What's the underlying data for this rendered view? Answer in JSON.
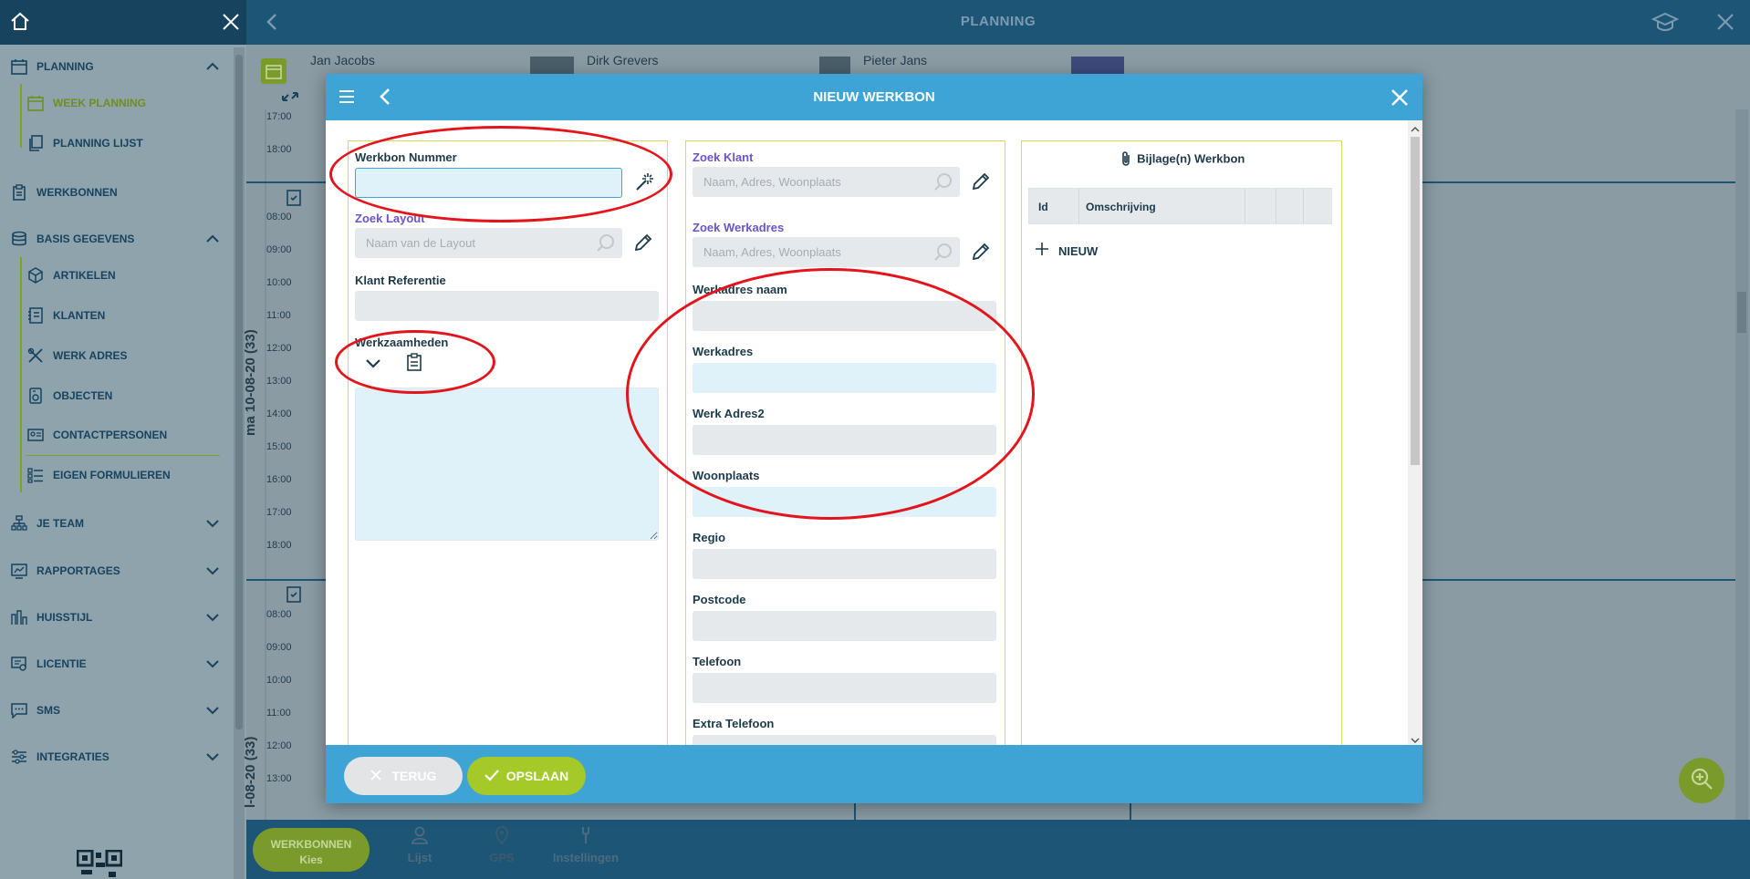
{
  "sidebar": {
    "items": [
      {
        "label": "PLANNING",
        "icon": "calendar-icon",
        "expanded": true
      },
      {
        "label": "WEEK PLANNING",
        "icon": "calendar-icon",
        "active": true
      },
      {
        "label": "PLANNING LIJST",
        "icon": "copy-icon"
      },
      {
        "label": "WERKBONNEN",
        "icon": "clipboard-icon"
      },
      {
        "label": "BASIS GEGEVENS",
        "icon": "database-icon",
        "expanded": true
      },
      {
        "label": "ARTIKELEN",
        "icon": "cube-icon"
      },
      {
        "label": "KLANTEN",
        "icon": "address-book-icon"
      },
      {
        "label": "WERK ADRES",
        "icon": "tools-icon"
      },
      {
        "label": "OBJECTEN",
        "icon": "object-icon"
      },
      {
        "label": "CONTACTPERSONEN",
        "icon": "contact-card-icon"
      },
      {
        "label": "EIGEN FORMULIEREN",
        "icon": "list-icon"
      },
      {
        "label": "JE TEAM",
        "icon": "team-icon"
      },
      {
        "label": "RAPPORTAGES",
        "icon": "report-icon"
      },
      {
        "label": "HUISSTIJL",
        "icon": "brand-icon"
      },
      {
        "label": "LICENTIE",
        "icon": "license-icon"
      },
      {
        "label": "SMS",
        "icon": "sms-icon"
      },
      {
        "label": "INTEGRATIES",
        "icon": "sliders-icon"
      }
    ]
  },
  "topbar": {
    "title": "PLANNING"
  },
  "planning": {
    "staff": [
      "Jan Jacobs",
      "Dirk Grevers",
      "Pieter Jans"
    ],
    "day_label_1": "ma 10-08-20 (33)",
    "day_label_2": "l-08-20 (33)",
    "times_top": [
      "17:00",
      "18:00"
    ],
    "times_day1": [
      "08:00",
      "09:00",
      "10:00",
      "11:00",
      "12:00",
      "13:00",
      "14:00",
      "15:00",
      "16:00",
      "17:00",
      "18:00"
    ],
    "times_day2": [
      "08:00",
      "09:00",
      "10:00",
      "11:00",
      "12:00",
      "13:00"
    ]
  },
  "bottombar": {
    "werkbonnen_label": "WERKBONNEN",
    "kies_label": "Kies",
    "lijst_label": "Lijst",
    "gps_label": "GPS",
    "instellingen_label": "Instellingen"
  },
  "modal": {
    "title": "NIEUW WERKBON",
    "left": {
      "werkbon_nummer_label": "Werkbon Nummer",
      "werkbon_nummer_value": "",
      "zoek_layout_label": "Zoek Layout",
      "zoek_layout_placeholder": "Naam van de Layout",
      "klant_referentie_label": "Klant Referentie",
      "werkzaamheden_label": "Werkzaamheden"
    },
    "middle": {
      "zoek_klant_label": "Zoek Klant",
      "zoek_klant_placeholder": "Naam, Adres, Woonplaats",
      "zoek_werkadres_label": "Zoek Werkadres",
      "zoek_werkadres_placeholder": "Naam, Adres, Woonplaats",
      "werkadres_naam_label": "Werkadres naam",
      "werkadres_label": "Werkadres",
      "werk_adres2_label": "Werk Adres2",
      "woonplaats_label": "Woonplaats",
      "regio_label": "Regio",
      "postcode_label": "Postcode",
      "telefoon_label": "Telefoon",
      "extra_telefoon_label": "Extra Telefoon"
    },
    "right": {
      "title": "Bijlage(n) Werkbon",
      "col_id": "Id",
      "col_omschrijving": "Omschrijving",
      "nieuw_label": "NIEUW"
    },
    "footer": {
      "terug_label": "TERUG",
      "opslaan_label": "OPSLAAN"
    }
  },
  "colors": {
    "header_blue": "#3ea4d6",
    "dark_blue": "#1d5577",
    "accent_green": "#a4c928",
    "annotation_red": "#e3141b"
  }
}
